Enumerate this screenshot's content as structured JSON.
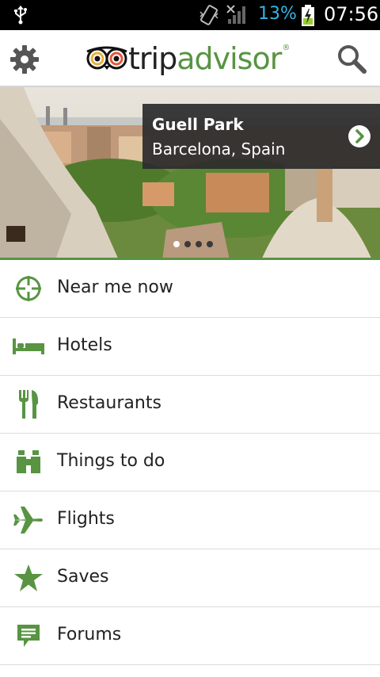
{
  "status_bar": {
    "battery_percent": "13%",
    "time": "07:56"
  },
  "app_bar": {
    "logo_trip": "trip",
    "logo_advisor": "advisor",
    "logo_reg": "®"
  },
  "hero": {
    "title": "Guell Park",
    "subtitle": "Barcelona, Spain",
    "carousel": {
      "pages": 4,
      "active": 1
    }
  },
  "menu": {
    "items": [
      {
        "label": "Near me now",
        "icon": "crosshair-icon"
      },
      {
        "label": "Hotels",
        "icon": "bed-icon"
      },
      {
        "label": "Restaurants",
        "icon": "fork-knife-icon"
      },
      {
        "label": "Things to do",
        "icon": "binoculars-icon"
      },
      {
        "label": "Flights",
        "icon": "airplane-icon"
      },
      {
        "label": "Saves",
        "icon": "star-icon"
      },
      {
        "label": "Forums",
        "icon": "chat-bubble-icon"
      }
    ]
  },
  "colors": {
    "brand_green": "#589442",
    "status_blue": "#33b5e5",
    "battery_green": "#9acd32"
  }
}
